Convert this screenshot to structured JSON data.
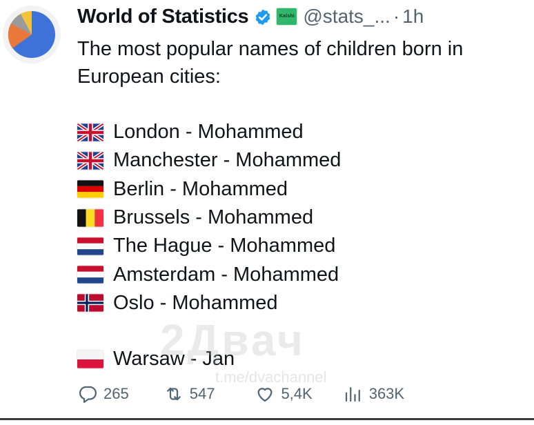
{
  "post": {
    "author_name": "World of Statistics",
    "affiliate_badge_text": "Kalshi",
    "handle": "@stats_...",
    "separator": "·",
    "time": "1h",
    "intro_text": "The most popular names of children born in European cities:",
    "entries": [
      {
        "flag": "uk-flag",
        "text": "London - Mohammed"
      },
      {
        "flag": "uk-flag",
        "text": "Manchester - Mohammed"
      },
      {
        "flag": "germany-flag",
        "text": "Berlin - Mohammed"
      },
      {
        "flag": "belgium-flag",
        "text": "Brussels - Mohammed"
      },
      {
        "flag": "netherlands-flag",
        "text": "The Hague - Mohammed"
      },
      {
        "flag": "netherlands-flag",
        "text": "Amsterdam - Mohammed"
      },
      {
        "flag": "norway-flag",
        "text": "Oslo - Mohammed"
      }
    ],
    "final_entry": {
      "flag": "poland-flag",
      "text": "Warsaw - Jan"
    }
  },
  "actions": {
    "replies": "265",
    "reposts": "547",
    "likes": "5,4K",
    "views": "363K"
  },
  "watermark": {
    "main": "2Двач",
    "sub": "t.me/dvachannel"
  },
  "colors": {
    "verified_blue": "#1d9bf0",
    "muted_text": "#536471",
    "primary_text": "#0f1419",
    "affiliate_green": "#2fb86a"
  }
}
